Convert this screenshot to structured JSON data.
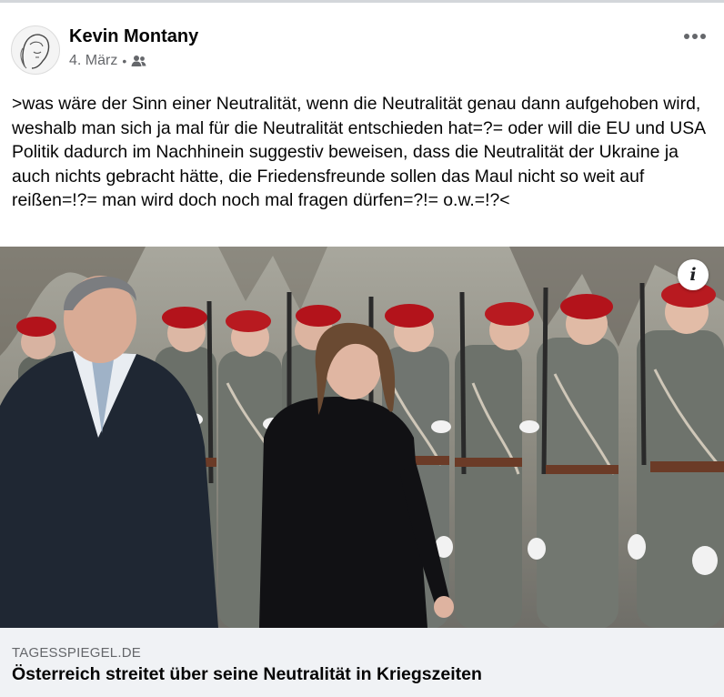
{
  "post": {
    "author": "Kevin Montany",
    "date": "4. März",
    "separator": "•",
    "audience_icon": "friends-icon",
    "text": ">was wäre der Sinn einer Neutralität, wenn die Neutralität genau dann aufgehoben wird, weshalb man sich ja mal für die Neutralität entschieden hat=?= oder will die EU und USA Politik dadurch im Nachhinein suggestiv beweisen, dass die Neutralität der Ukraine ja auch nichts gebracht hätte, die Friedensfreunde sollen das Maul nicht so weit auf reißen=!?= man wird doch noch mal fragen dürfen=?!= o.w.=!?<"
  },
  "link": {
    "domain": "TAGESSPIEGEL.DE",
    "headline": "Österreich streitet über seine Neutralität in Kriegszeiten",
    "info_icon": "i"
  },
  "colors": {
    "secondary_text": "#65676b",
    "caption_bg": "#f0f2f5",
    "beret_red": "#b3131b",
    "uniform_gray": "#6f746d"
  }
}
